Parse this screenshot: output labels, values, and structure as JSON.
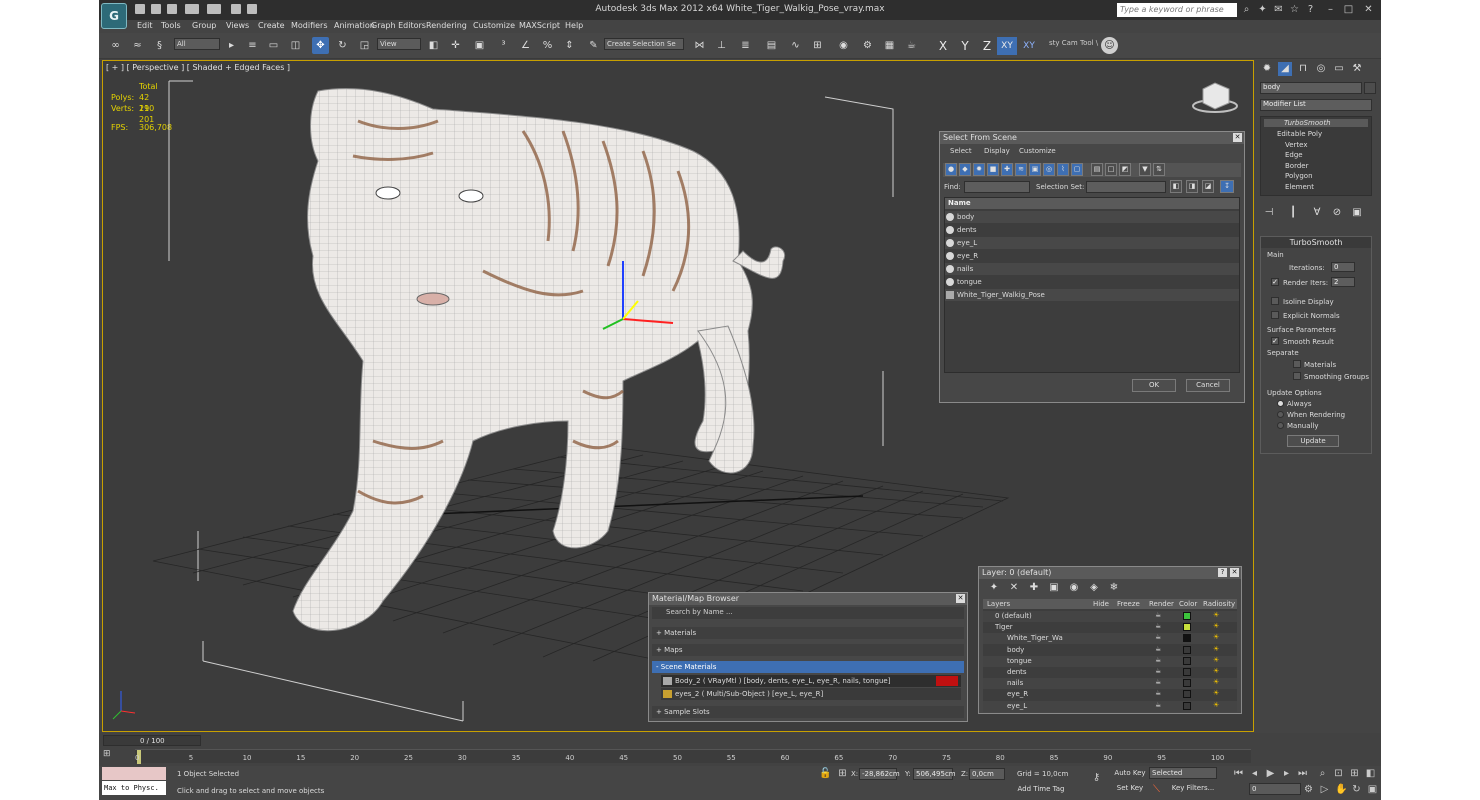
{
  "titlebar": {
    "title": "Autodesk 3ds Max  2012 x64     White_Tiger_Walkig_Pose_vray.max",
    "search_placeholder": "Type a keyword or phrase"
  },
  "menu": [
    "Edit",
    "Tools",
    "Group",
    "Views",
    "Create",
    "Modifiers",
    "Animation",
    "Graph Editors",
    "Rendering",
    "Customize",
    "MAXScript",
    "Help"
  ],
  "toolbar": {
    "filter_value": "All",
    "refcoord_value": "View",
    "selection_set_value": "Create Selection Se",
    "axis_x": "X",
    "axis_y": "Y",
    "axis_z": "Z",
    "axis_xy": "XY",
    "axis_xy2": "XY",
    "custom_tool": "sty Cam Tool \\"
  },
  "viewport": {
    "label": "[ + ] [ Perspective ] [ Shaded + Edged Faces ]",
    "stats_total_label": "Total",
    "polys_label": "Polys:",
    "polys_value": "42 190",
    "verts_label": "Verts:",
    "verts_value": "21 201",
    "fps_label": "FPS:",
    "fps_value": "306,708",
    "viewcube_text": "FRONT"
  },
  "select_from_scene": {
    "title": "Select From Scene",
    "menu": [
      "Select",
      "Display",
      "Customize"
    ],
    "find_label": "Find:",
    "selection_set_label": "Selection Set:",
    "column_name": "Name",
    "items": [
      "body",
      "dents",
      "eye_L",
      "eye_R",
      "nails",
      "tongue",
      "White_Tiger_Walkig_Pose"
    ],
    "ok": "OK",
    "cancel": "Cancel"
  },
  "material_browser": {
    "title": "Material/Map Browser",
    "search_placeholder": "Search by Name ...",
    "materials": "+ Materials",
    "maps": "+ Maps",
    "scene_materials": "- Scene Materials",
    "body_material": "Body_2  ( VRayMtl )  [body, dents, eye_L, eye_R, nails, tongue]",
    "eyes_material": "eyes_2  ( Multi/Sub-Object )  [eye_L, eye_R]",
    "sample_slots": "+ Sample Slots"
  },
  "layer_dialog": {
    "title": "Layer: 0 (default)",
    "columns": [
      "Layers",
      "Hide",
      "Freeze",
      "Render",
      "Color",
      "Radiosity"
    ],
    "rows": [
      "0 (default)",
      "Tiger",
      "White_Tiger_Wa",
      "body",
      "tongue",
      "dents",
      "nails",
      "eye_R",
      "eye_L"
    ],
    "colors": [
      "#3cc43c",
      "#c8e03c",
      "#111111",
      "#3a3a3a",
      "#3a3a3a",
      "#3a3a3a",
      "#3a3a3a",
      "#3a3a3a",
      "#3a3a3a"
    ]
  },
  "command_panel": {
    "object_name": "body",
    "modifier_list": "Modifier List",
    "stack": [
      "TurboSmooth",
      "Editable Poly",
      "Vertex",
      "Edge",
      "Border",
      "Polygon",
      "Element"
    ],
    "turbosmooth_title": "TurboSmooth",
    "main_label": "Main",
    "iterations_label": "Iterations:",
    "iterations_value": "0",
    "render_iters_label": "Render Iters:",
    "render_iters_value": "2",
    "isoline_display": "Isoline Display",
    "explicit_normals": "Explicit Normals",
    "surface_parameters": "Surface Parameters",
    "smooth_result": "Smooth Result",
    "separate": "Separate",
    "materials": "Materials",
    "smoothing_groups": "Smoothing Groups",
    "update_options": "Update Options",
    "always": "Always",
    "when_rendering": "When Rendering",
    "manually": "Manually",
    "update_button": "Update"
  },
  "timeline": {
    "frame_display": "0 / 100",
    "ticks": [
      "0",
      "5",
      "10",
      "15",
      "20",
      "25",
      "30",
      "35",
      "40",
      "45",
      "50",
      "55",
      "60",
      "65",
      "70",
      "75",
      "80",
      "85",
      "90",
      "95",
      "100"
    ]
  },
  "statusbar": {
    "maxscript_listener": "Max to Physc.",
    "selection_status": "1 Object Selected",
    "prompt": "Click and drag to select and move objects",
    "x_label": "X:",
    "x_value": "-28,862cm",
    "y_label": "Y:",
    "y_value": "506,495cm",
    "z_label": "Z:",
    "z_value": "0,0cm",
    "grid": "Grid = 10,0cm",
    "add_time_tag": "Add Time Tag",
    "auto_key": "Auto Key",
    "set_key": "Set Key",
    "selected_dropdown": "Selected",
    "key_filters": "Key Filters...",
    "frame_value": "0"
  }
}
